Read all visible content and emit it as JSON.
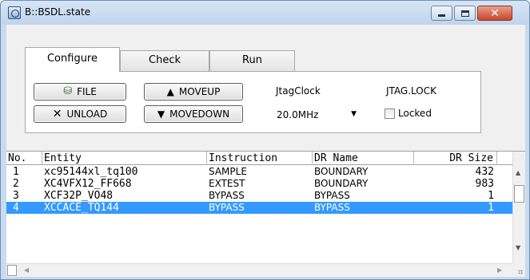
{
  "window": {
    "title": "B::BSDL.state"
  },
  "tabs": [
    {
      "label": "Configure",
      "active": true
    },
    {
      "label": "Check",
      "active": false
    },
    {
      "label": "Run",
      "active": false
    }
  ],
  "configure": {
    "file_label": "FILE",
    "unload_label": "UNLOAD",
    "moveup_label": "MOVEUP",
    "movedown_label": "MOVEDOWN",
    "jtagclock_label": "JtagClock",
    "jtagclock_value": "20.0MHz",
    "jtaglock_label": "JTAG.LOCK",
    "locked_label": "Locked",
    "locked_checked": false
  },
  "table": {
    "columns": [
      "No.",
      "Entity",
      "Instruction",
      "DR Name",
      "DR Size"
    ],
    "rows": [
      {
        "no": "1",
        "entity": "xc95144xl_tq100",
        "instruction": "SAMPLE",
        "dr_name": "BOUNDARY",
        "dr_size": "432",
        "selected": false
      },
      {
        "no": "2",
        "entity": "XC4VFX12_FF668",
        "instruction": "EXTEST",
        "dr_name": "BOUNDARY",
        "dr_size": "983",
        "selected": false
      },
      {
        "no": "3",
        "entity": "XCF32P_VO48",
        "instruction": "BYPASS",
        "dr_name": "BYPASS",
        "dr_size": "1",
        "selected": false
      },
      {
        "no": "4",
        "entity": "XCCACE_TQ144",
        "instruction": "BYPASS",
        "dr_name": "BYPASS",
        "dr_size": "1",
        "selected": true
      }
    ]
  },
  "colors": {
    "selection": "#3399ff",
    "titlebar": "#bfd4ec",
    "close_button": "#c7452a"
  },
  "icons": {
    "app": "window-app-icon",
    "file": "file-load-icon",
    "unload": "x-icon",
    "moveup": "triangle-up-icon",
    "movedown": "triangle-down-icon"
  }
}
